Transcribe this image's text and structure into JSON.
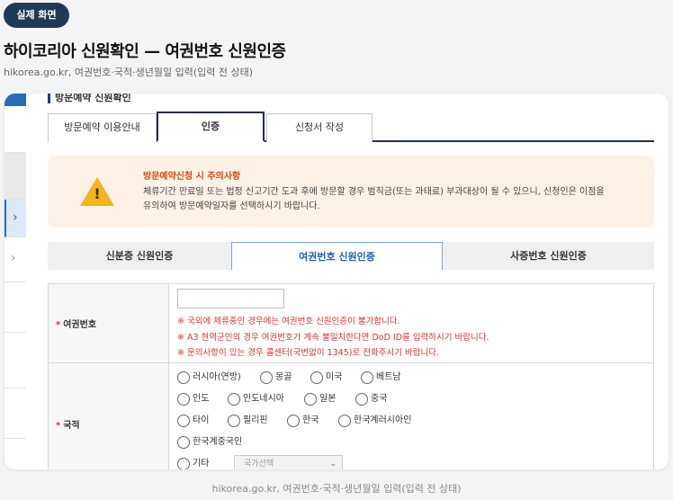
{
  "badge": "실제 화면",
  "page_title": "하이코리아 신원확인 — 여권번호 신원인증",
  "page_subtitle": "hikorea.go.kr, 여권번호·국적·생년월일 입력(입력 전 상태)",
  "caption": "hikorea.go.kr, 여권번호·국적·생년월일 입력(입력 전 상태)",
  "section_title": "방문예약 신원확인",
  "main_tabs": [
    {
      "label": "방문예약 이용안내"
    },
    {
      "label": "인증"
    },
    {
      "label": "신청서 작성"
    }
  ],
  "notice": {
    "title": "방문예약신청 시 주의사항",
    "line1": "체류기간 만료일 또는 법정 신고기간 도과 후에 방문할 경우 범칙금(또는 과태료) 부과대상이 될 수 있으니, 신청인은 이점을",
    "line2": "유의하여 방문예약일자를 선택하시기 바랍니다.",
    "icon": "warning-icon"
  },
  "auth_tabs": [
    {
      "label": "신분증 신원인증"
    },
    {
      "label": "여권번호 신원인증"
    },
    {
      "label": "사증번호 신원인증"
    }
  ],
  "form": {
    "required_mark": "*",
    "passport_label": "여권번호",
    "passport_value": "",
    "passport_notes": [
      "※ 국외에 체류중인 경우에는 여권번호 신원인증이 불가합니다.",
      "※ A3 현역군인의 경우 여권번호가 계속 불일치한다면 DoD ID를 입력하시기 바랍니다.",
      "※ 문의사항이 있는 경우 콜센터(국번없이 1345)로 전화주시기 바랍니다."
    ],
    "nationality_label": "국적",
    "countries": [
      "러시아(연방)",
      "몽골",
      "미국",
      "베트남",
      "인도",
      "인도네시아",
      "일본",
      "중국",
      "타이",
      "필리핀",
      "한국",
      "한국계러시아인",
      "한국계중국인",
      "기타"
    ],
    "country_select_placeholder": "국가선택"
  },
  "colors": {
    "badge_bg": "#1f3a55",
    "accent_blue": "#2a6ab8",
    "notice_bg": "#fdf1e6",
    "notice_title": "#d9480f",
    "warning_red": "#e03131",
    "warning_icon": "#f2b51d"
  }
}
